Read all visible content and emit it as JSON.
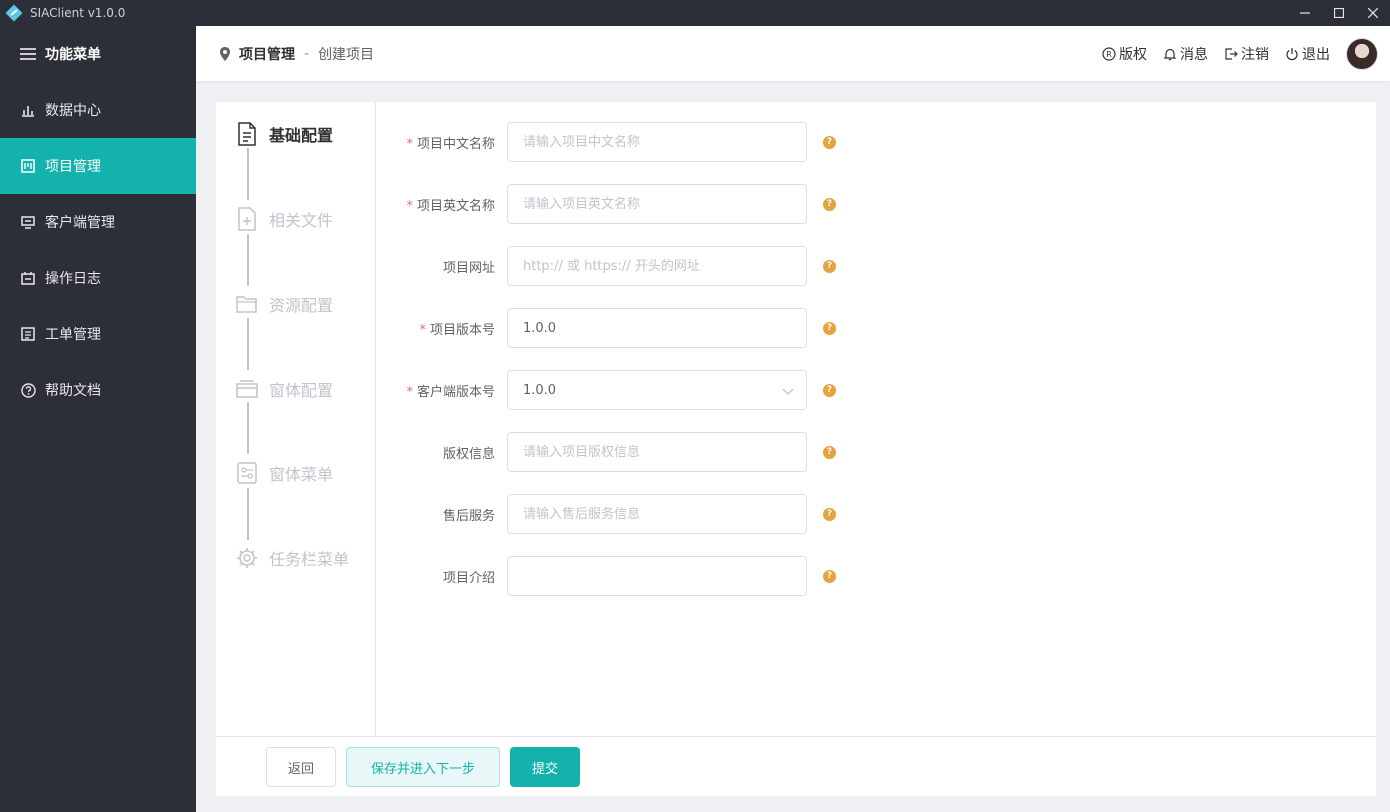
{
  "window": {
    "title": "SIAClient v1.0.0"
  },
  "sidebar": {
    "header_label": "功能菜单",
    "items": [
      {
        "label": "数据中心",
        "icon": "bar-chart-icon"
      },
      {
        "label": "项目管理",
        "icon": "project-icon",
        "active": true
      },
      {
        "label": "客户端管理",
        "icon": "monitor-icon"
      },
      {
        "label": "操作日志",
        "icon": "calendar-icon"
      },
      {
        "label": "工单管理",
        "icon": "document-icon"
      },
      {
        "label": "帮助文档",
        "icon": "question-icon"
      }
    ]
  },
  "header": {
    "breadcrumb": {
      "root": "项目管理",
      "separator": "-",
      "current": "创建项目"
    },
    "actions": [
      {
        "label": "版权",
        "icon": "registered-icon"
      },
      {
        "label": "消息",
        "icon": "bell-icon"
      },
      {
        "label": "注销",
        "icon": "logout-icon"
      },
      {
        "label": "退出",
        "icon": "power-icon"
      }
    ]
  },
  "steps": [
    {
      "label": "基础配置",
      "icon": "document-icon",
      "active": true
    },
    {
      "label": "相关文件",
      "icon": "file-add-icon"
    },
    {
      "label": "资源配置",
      "icon": "folder-icon"
    },
    {
      "label": "窗体配置",
      "icon": "window-icon"
    },
    {
      "label": "窗体菜单",
      "icon": "settings-panel-icon"
    },
    {
      "label": "任务栏菜单",
      "icon": "gear-icon"
    }
  ],
  "form": {
    "fields": [
      {
        "label": "项目中文名称",
        "required": true,
        "value": "",
        "placeholder": "请输入项目中文名称"
      },
      {
        "label": "项目英文名称",
        "required": true,
        "value": "",
        "placeholder": "请输入项目英文名称"
      },
      {
        "label": "项目网址",
        "required": false,
        "value": "",
        "placeholder": "http:// 或 https:// 开头的网址"
      },
      {
        "label": "项目版本号",
        "required": true,
        "value": "1.0.0",
        "placeholder": ""
      },
      {
        "label": "客户端版本号",
        "required": true,
        "value": "1.0.0",
        "type": "select"
      },
      {
        "label": "版权信息",
        "required": false,
        "value": "",
        "placeholder": "请输入项目版权信息"
      },
      {
        "label": "售后服务",
        "required": false,
        "value": "",
        "placeholder": "请输入售后服务信息"
      },
      {
        "label": "项目介绍",
        "required": false,
        "value": "",
        "placeholder": ""
      }
    ],
    "help_glyph": "?"
  },
  "footer": {
    "back_label": "返回",
    "save_next_label": "保存并进入下一步",
    "submit_label": "提交"
  },
  "colors": {
    "accent": "#13b2ad",
    "sidebar_bg": "#2d2f38",
    "required": "#f56c6c",
    "help": "#e6a23c"
  }
}
